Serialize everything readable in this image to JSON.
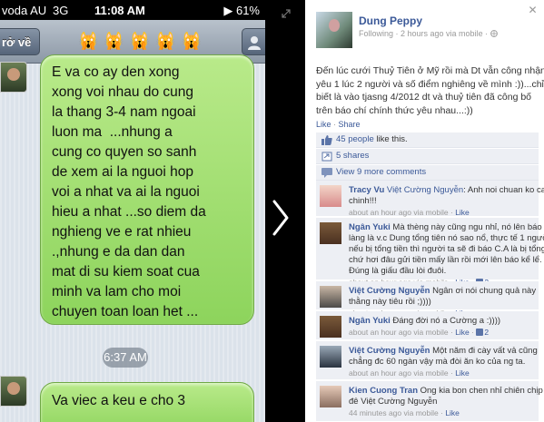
{
  "phone": {
    "status": {
      "carrier": "voda AU",
      "network": "3G",
      "time": "11:08 AM",
      "battery": "▶ 61%"
    },
    "nav": {
      "back": "rở về",
      "title": "🙀🙀🙀🙀🙀"
    },
    "messages": [
      {
        "text": "E va co ay den xong\nxong voi nhau do cung\nla thang 3-4 nam ngoai\nluon ma  ...nhung a\ncung co quyen so sanh\nde xem ai la nguoi hop\nvoi a nhat va ai la nguoi\nhieu a nhat ...so diem da\nnghieng ve e rat nhieu\n.,nhung e da dan dan\nmat di su kiem soat cua\nminh va lam cho moi\nchuyen toan loan het ..."
      },
      {
        "text": "Va viec a keu e cho 3"
      }
    ],
    "timestamp": "6:37 AM"
  },
  "panel": {
    "owner": {
      "name": "Dung Peppy",
      "meta": "Following · 2 hours ago via mobile · "
    },
    "caption": "Đến lúc cưới Thuỷ Tiên ở Mỹ rồi mà Dt vẫn công nhận\nyêu 1 lúc 2 người và số điểm nghiêng về mình :))...chỉ\nbiết là vào tjasng 4/2012 dt và thuỷ tiên đã công bố\ntrên báo chí chính thức yêu nhau...:))",
    "actions": {
      "like": "Like",
      "dot": " · ",
      "share": "Share"
    },
    "likes": {
      "count_link": "45 people",
      "suffix": " like this."
    },
    "shares": "5 shares",
    "more": "View 9 more comments",
    "comments": [
      {
        "name": "Tracy Vu",
        "tag": " Việt Cường Nguyễn",
        "text": ": Anh noi chuan ko can\nchinh!!!",
        "time": "about an hour ago via mobile · ",
        "like": "Like",
        "count": ""
      },
      {
        "name": "Ngân Yuki",
        "tag": "",
        "text": " Mà thèng này cũng ngu nhỉ, nó lên báo la\nlàng là v.c Dung tổng tiên nó sao nổ, thực tế 1 người\nnếu bị tổng tiền thì người ta sẽ đi báo C.A là bị tổng tiền\nchứ hơi đâu gửi tiền mấy lần rồi mới lên báo kể lể.\nĐúng là giấu đầu lòi đuôi.",
        "time": "about an hour ago via mobile · ",
        "like": "Like",
        "count": "2"
      },
      {
        "name": "Việt Cường Nguyễn",
        "tag": "",
        "text": " Ngân ơi nói chung quả này\nthằng này tiêu rồi ;))))",
        "time": "about an hour ago via mobile · ",
        "like": "Like",
        "count": ""
      },
      {
        "name": "Ngân Yuki",
        "tag": "",
        "text": " Đáng đời nó a Cường a :))))",
        "time": "about an hour ago via mobile · ",
        "like": "Like",
        "count": "2"
      },
      {
        "name": "Việt Cường Nguyễn",
        "tag": "",
        "text": " Một năm đi cày vất vả cũng\nchẳng đc 60 ngàn vậy mà đòi ăn ko của ng ta.",
        "time": "about an hour ago via mobile · ",
        "like": "Like",
        "count": ""
      },
      {
        "name": "Kien Cuong Tran",
        "tag": "",
        "text": " Ong kia bon chen nhỉ chiên chịp\nđê Việt Cường Nguyễn",
        "time": "44 minutes ago via mobile · ",
        "like": "Like",
        "count": ""
      }
    ]
  }
}
